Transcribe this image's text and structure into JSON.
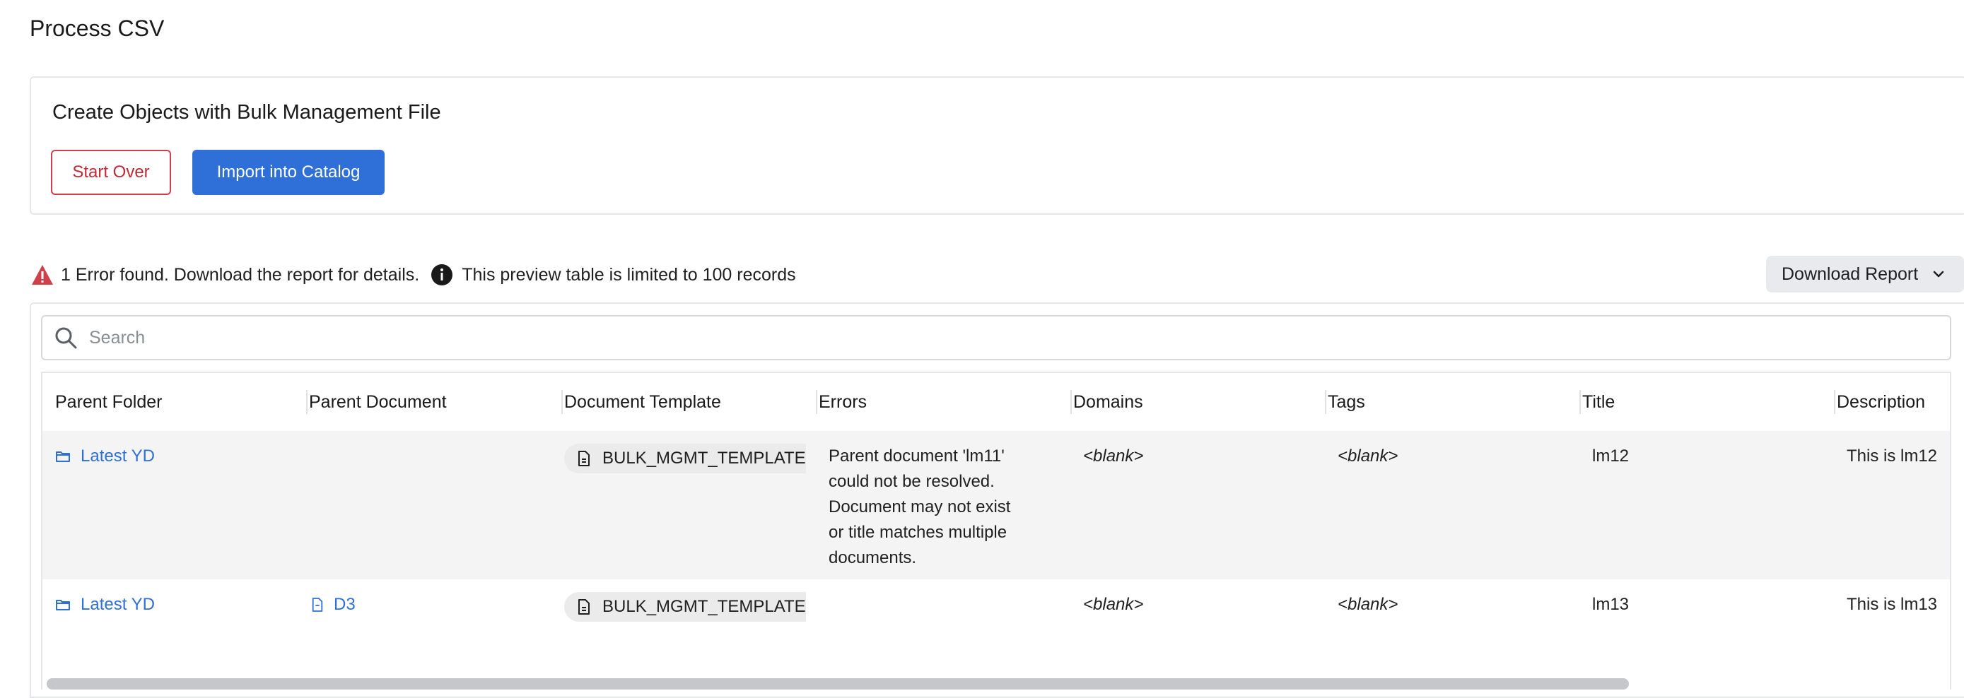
{
  "page": {
    "title": "Process CSV"
  },
  "card": {
    "title": "Create Objects with Bulk Management File",
    "start_over_label": "Start Over",
    "import_label": "Import into Catalog"
  },
  "status": {
    "error_text": "1 Error found. Download the report for details.",
    "preview_text": "This preview table is limited to 100 records",
    "error_color": "#d0404b"
  },
  "download": {
    "label": "Download Report"
  },
  "search": {
    "placeholder": "Search"
  },
  "table": {
    "columns": [
      "Parent Folder",
      "Parent Document",
      "Document Template",
      "Errors",
      "Domains",
      "Tags",
      "Title",
      "Description"
    ],
    "rows": [
      {
        "parent_folder": "Latest YD",
        "parent_document": "",
        "document_template": "BULK_MGMT_TEMPLATE",
        "errors": [
          "Parent document 'lm11'",
          "could not be resolved.",
          "Document may not exist",
          "or title matches multiple",
          "documents."
        ],
        "domains": "<blank>",
        "tags": "<blank>",
        "title": "lm12",
        "description": "This is lm12"
      },
      {
        "parent_folder": "Latest YD",
        "parent_document": "D3",
        "document_template": "BULK_MGMT_TEMPLATE",
        "errors": [],
        "domains": "<blank>",
        "tags": "<blank>",
        "title": "lm13",
        "description": "This is lm13"
      }
    ]
  },
  "colors": {
    "accent": "#2e6fd8",
    "danger": "#d0404b",
    "row_highlight": "#f4f4f4"
  },
  "icons": {
    "warning": "warning-triangle-icon",
    "info": "info-circle-icon",
    "folder": "folder-icon",
    "document": "document-icon",
    "search": "search-icon",
    "chevron": "chevron-down-icon"
  }
}
